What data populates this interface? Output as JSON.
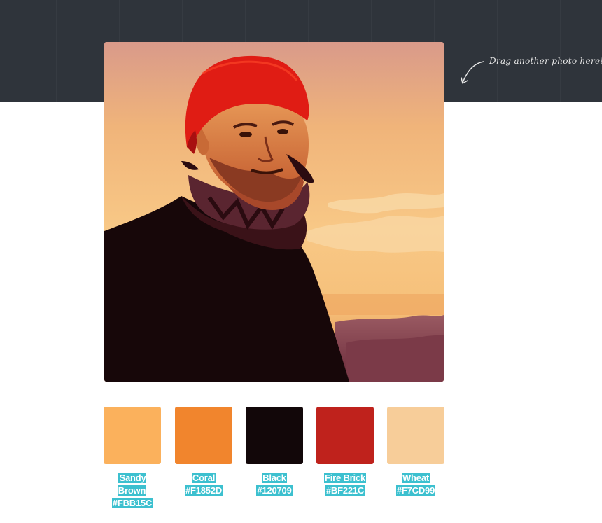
{
  "hint": {
    "text": "Drag another photo here!",
    "icon": "curved-arrow-icon"
  },
  "photo": {
    "subject": "man in red beanie at sunset"
  },
  "palette": [
    {
      "name": "Sandy Brown",
      "hex": "#FBB15C",
      "color": "#FBB15C"
    },
    {
      "name": "Coral",
      "hex": "#F1852D",
      "color": "#F1852D"
    },
    {
      "name": "Black",
      "hex": "#120709",
      "color": "#120709"
    },
    {
      "name": "Fire Brick",
      "hex": "#BF221C",
      "color": "#BF221C"
    },
    {
      "name": "Wheat",
      "hex": "#F7CD99",
      "color": "#F7CD99"
    }
  ],
  "colors": {
    "header_bg": "#2F343B",
    "label_highlight": "#3CC0CF"
  }
}
